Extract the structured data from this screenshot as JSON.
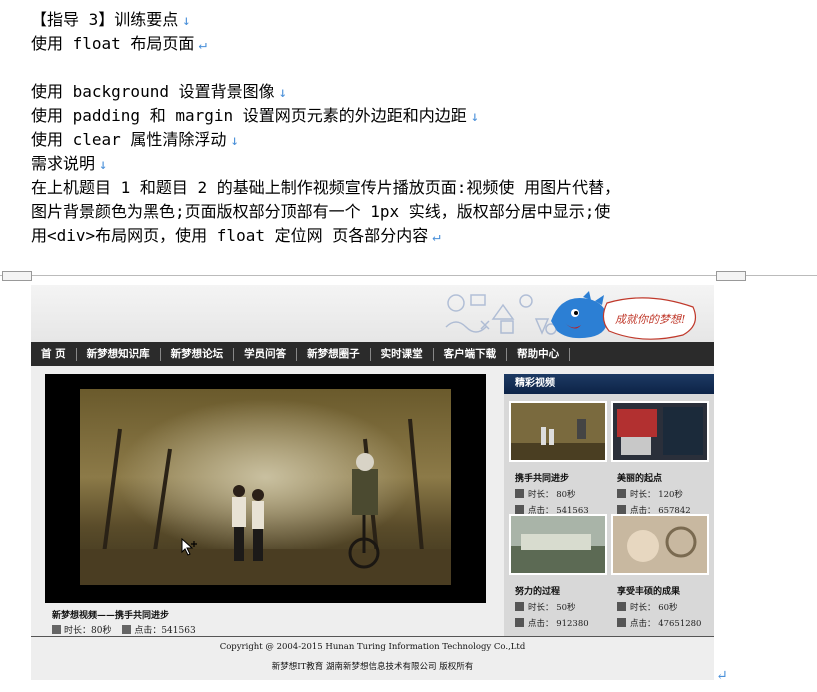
{
  "doc": {
    "lines": [
      "【指导 3】训练要点",
      "使用 float 布局页面",
      "",
      "使用 background 设置背景图像",
      "使用 padding 和 margin 设置网页元素的外边距和内边距",
      "使用 clear 属性清除浮动",
      "需求说明",
      "在上机题目 1 和题目 2 的基础上制作视频宣传片播放页面:视频使 用图片代替，",
      "图片背景颜色为黑色;页面版权部分顶部有一个 1px 实线，版权部分居中显示;使",
      "用<div>布局网页，使用 float 定位网 页各部分内容"
    ],
    "mark_down": "↓",
    "mark_return": "↵"
  },
  "site": {
    "mascot_text": "成就你的梦想!",
    "nav": [
      "首 页",
      "新梦想知识库",
      "新梦想论坛",
      "学员问答",
      "新梦想圈子",
      "实时课堂",
      "客户端下载",
      "帮助中心"
    ],
    "main_video": {
      "caption": "新梦想视频——携手共同进步",
      "duration_label": "时长：80秒",
      "clicks_label": "点击：541563"
    },
    "sidebar_title": "精彩视频",
    "cards": [
      {
        "name": "携手共同进步",
        "duration": "时长： 80秒",
        "clicks": "点击： 541563"
      },
      {
        "name": "美丽的起点",
        "duration": "时长： 120秒",
        "clicks": "点击： 657842"
      },
      {
        "name": "努力的过程",
        "duration": "时长： 50秒",
        "clicks": "点击： 912380"
      },
      {
        "name": "享受丰硕的成果",
        "duration": "时长： 60秒",
        "clicks": "点击： 47651280"
      }
    ],
    "copyright": "Copyright @ 2004-2015 Hunan Turing Information Technology Co.,Ltd",
    "company": "新梦想IT教育 湖南新梦想信息技术有限公司 版权所有"
  },
  "colors": {
    "nav_bg": "#2b2b2b",
    "sidebar_header": "#0d2347",
    "paragraph_mark": "#4a90d9"
  }
}
